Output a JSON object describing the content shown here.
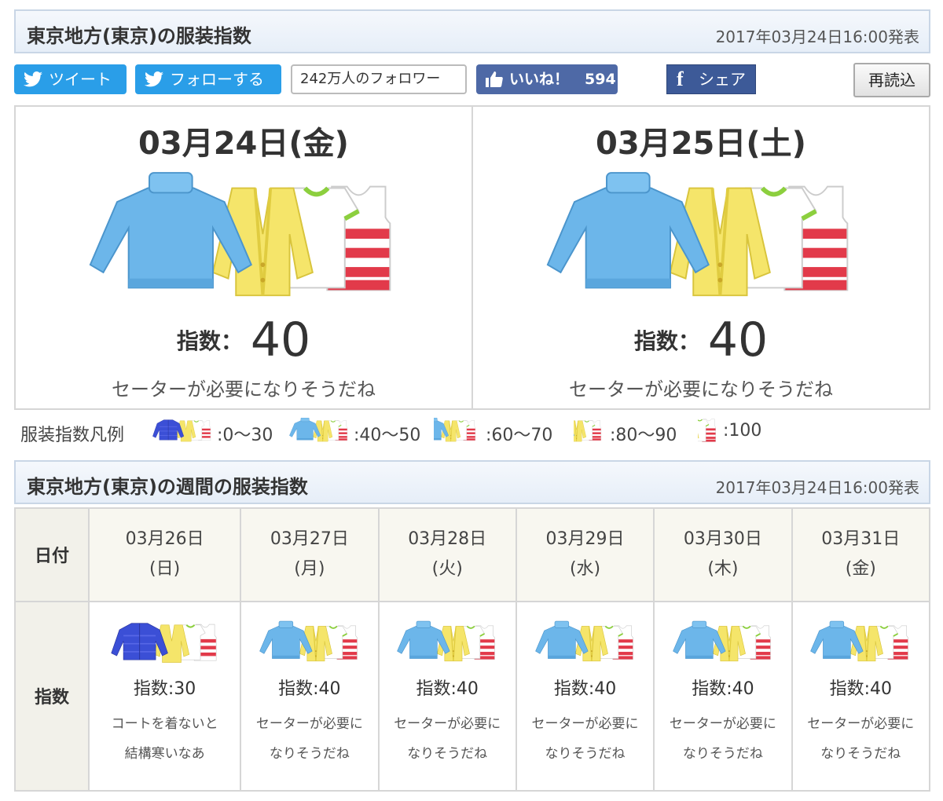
{
  "today_header": {
    "title": "東京地方(東京)の服装指数",
    "published": "2017年03月24日16:00発表"
  },
  "share": {
    "tweet_label": "ツイート",
    "follow_label": "フォローする",
    "followers_text": "242万人のフォロワー",
    "like_label": "いいね！",
    "like_count": "594",
    "share_label": "シェア",
    "reload_label": "再読込"
  },
  "days": [
    {
      "date": "03月24日(金)",
      "index_label": "指数：",
      "index_value": "40",
      "comment": "セーターが必要になりそうだね",
      "icon": "sweater-clothes-icon"
    },
    {
      "date": "03月25日(土)",
      "index_label": "指数：",
      "index_value": "40",
      "comment": "セーターが必要になりそうだね",
      "icon": "sweater-clothes-icon"
    }
  ],
  "legend": {
    "title": "服装指数凡例",
    "items": [
      {
        "range": ":0～30",
        "icon": "down-jacket-icon"
      },
      {
        "range": ":40～50",
        "icon": "sweater-icon"
      },
      {
        "range": ":60～70",
        "icon": "cardigan-icon"
      },
      {
        "range": ":80～90",
        "icon": "tshirt-icon"
      },
      {
        "range": ":100",
        "icon": "tank-top-icon"
      }
    ]
  },
  "week_header": {
    "title": "東京地方(東京)の週間の服装指数",
    "published": "2017年03月24日16:00発表"
  },
  "week": {
    "row_date_label": "日付",
    "row_index_label": "指数",
    "days": [
      {
        "date": "03月26日",
        "dow": "(日)",
        "index": "指数:30",
        "comment1": "コートを着ないと",
        "comment2": "結構寒いなあ",
        "icon": "down-jacket-clothes-icon"
      },
      {
        "date": "03月27日",
        "dow": "(月)",
        "index": "指数:40",
        "comment1": "セーターが必要に",
        "comment2": "なりそうだね",
        "icon": "sweater-clothes-icon"
      },
      {
        "date": "03月28日",
        "dow": "(火)",
        "index": "指数:40",
        "comment1": "セーターが必要に",
        "comment2": "なりそうだね",
        "icon": "sweater-clothes-icon"
      },
      {
        "date": "03月29日",
        "dow": "(水)",
        "index": "指数:40",
        "comment1": "セーターが必要に",
        "comment2": "なりそうだね",
        "icon": "sweater-clothes-icon"
      },
      {
        "date": "03月30日",
        "dow": "(木)",
        "index": "指数:40",
        "comment1": "セーターが必要に",
        "comment2": "なりそうだね",
        "icon": "sweater-clothes-icon"
      },
      {
        "date": "03月31日",
        "dow": "(金)",
        "index": "指数:40",
        "comment1": "セーターが必要に",
        "comment2": "なりそうだね",
        "icon": "sweater-clothes-icon"
      }
    ]
  },
  "colors": {
    "twitter": "#2a9ee8",
    "facebook": "#4e69a6",
    "header_border": "#c9d6e6",
    "sweater": "#6cb6ea",
    "down_jacket": "#3b4fd6",
    "cardigan": "#f5e56a",
    "stripe": "#e23a4a"
  }
}
